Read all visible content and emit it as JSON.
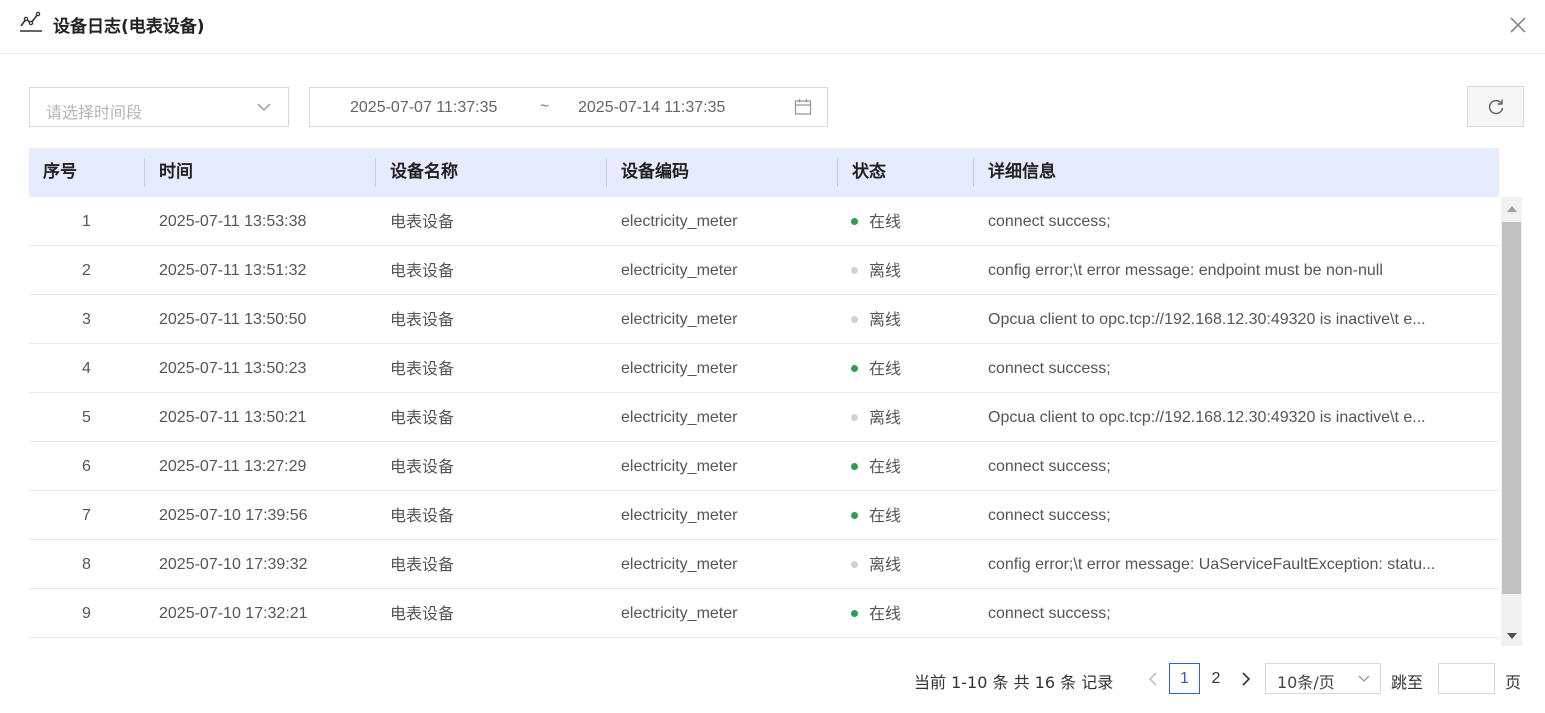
{
  "dialog": {
    "title": "设备日志(电表设备)",
    "icon": "line-chart-icon",
    "close_icon": "close-icon"
  },
  "filters": {
    "period_placeholder": "请选择时间段",
    "range_start": "2025-07-07 11:37:35",
    "range_separator": "~",
    "range_end": "2025-07-14 11:37:35",
    "calendar_icon": "calendar-icon",
    "refresh_icon": "refresh-icon"
  },
  "table": {
    "columns": [
      "序号",
      "时间",
      "设备名称",
      "设备编码",
      "状态",
      "详细信息"
    ],
    "rows": [
      {
        "index": "1",
        "time": "2025-07-11 13:53:38",
        "name": "电表设备",
        "code": "electricity_meter",
        "status": "在线",
        "online": true,
        "detail": "connect success;"
      },
      {
        "index": "2",
        "time": "2025-07-11 13:51:32",
        "name": "电表设备",
        "code": "electricity_meter",
        "status": "离线",
        "online": false,
        "detail": "config error;\\t error message: endpoint must be non-null"
      },
      {
        "index": "3",
        "time": "2025-07-11 13:50:50",
        "name": "电表设备",
        "code": "electricity_meter",
        "status": "离线",
        "online": false,
        "detail": "Opcua client to opc.tcp://192.168.12.30:49320 is inactive\\t e..."
      },
      {
        "index": "4",
        "time": "2025-07-11 13:50:23",
        "name": "电表设备",
        "code": "electricity_meter",
        "status": "在线",
        "online": true,
        "detail": "connect success;"
      },
      {
        "index": "5",
        "time": "2025-07-11 13:50:21",
        "name": "电表设备",
        "code": "electricity_meter",
        "status": "离线",
        "online": false,
        "detail": "Opcua client to opc.tcp://192.168.12.30:49320 is inactive\\t e..."
      },
      {
        "index": "6",
        "time": "2025-07-11 13:27:29",
        "name": "电表设备",
        "code": "electricity_meter",
        "status": "在线",
        "online": true,
        "detail": "connect success;"
      },
      {
        "index": "7",
        "time": "2025-07-10 17:39:56",
        "name": "电表设备",
        "code": "electricity_meter",
        "status": "在线",
        "online": true,
        "detail": "connect success;"
      },
      {
        "index": "8",
        "time": "2025-07-10 17:39:32",
        "name": "电表设备",
        "code": "electricity_meter",
        "status": "离线",
        "online": false,
        "detail": "config error;\\t error message: UaServiceFaultException: statu..."
      },
      {
        "index": "9",
        "time": "2025-07-10 17:32:21",
        "name": "电表设备",
        "code": "electricity_meter",
        "status": "在线",
        "online": true,
        "detail": "connect success;"
      }
    ]
  },
  "colors": {
    "online_dot": "#2e9e4f",
    "offline_dot": "#d0d0d0",
    "header_bg": "#e6ecfd",
    "accent": "#2b5fd9"
  },
  "pagination": {
    "summary": "当前 1-10 条 共 16 条 记录",
    "pages": [
      "1",
      "2"
    ],
    "current_page": "1",
    "page_size": "10条/页",
    "jump_label": "跳至",
    "jump_value": "",
    "page_suffix": "页"
  }
}
